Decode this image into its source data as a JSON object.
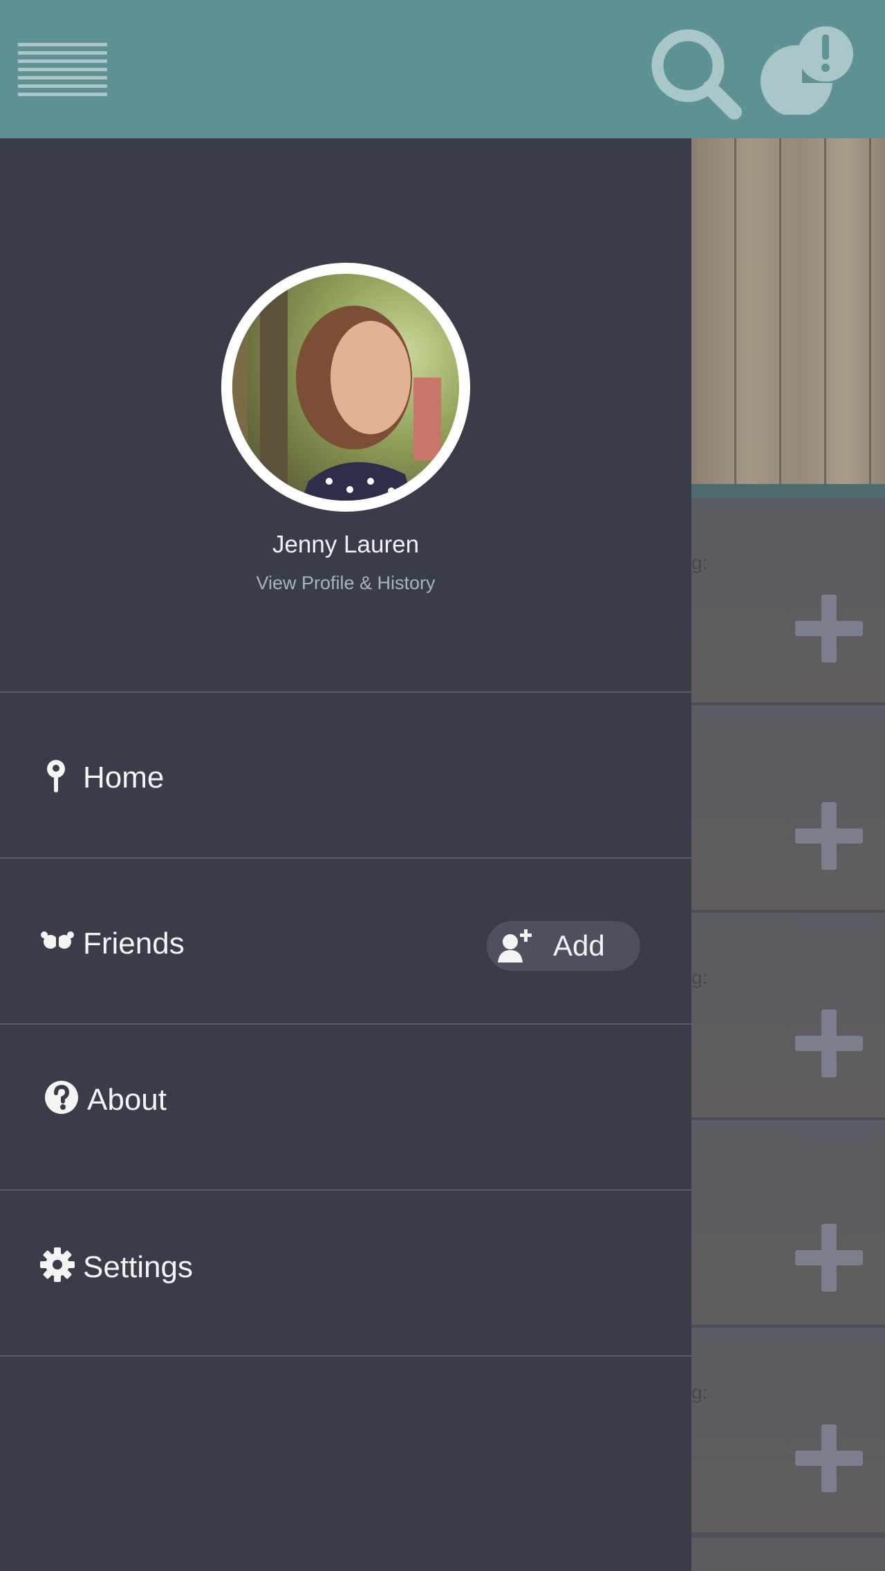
{
  "colors": {
    "topbar": "#5e9294",
    "drawer": "#3a3c4a",
    "divider": "#5a5d6c",
    "link": "#a4b5c2",
    "icon_light": "#a9c7c8"
  },
  "topbar": {
    "menu_icon": "hamburger-icon",
    "search_icon": "search-icon",
    "alert_icon": "notification-alert-icon"
  },
  "profile": {
    "name": "Jenny Lauren",
    "link": "View Profile & History"
  },
  "menu": {
    "items": [
      {
        "label": "Home",
        "icon": "location-pin-icon"
      },
      {
        "label": "Friends",
        "icon": "friends-icon",
        "action": {
          "label": "Add",
          "icon": "add-user-icon"
        }
      },
      {
        "label": "About",
        "icon": "question-circle-icon"
      },
      {
        "label": "Settings",
        "icon": "gear-icon"
      }
    ]
  },
  "background": {
    "card_fragments": [
      "g:",
      "g:",
      "g:"
    ],
    "card_icon": "plus-icon"
  }
}
